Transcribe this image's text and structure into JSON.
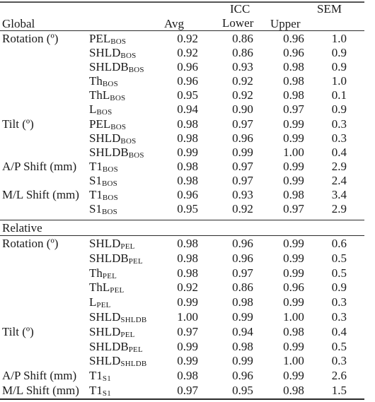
{
  "header": {
    "section_global": "Global",
    "col_avg": "Avg",
    "col_icc": "ICC",
    "col_lower": "Lower",
    "col_upper": "Upper",
    "col_sem": "SEM"
  },
  "global_rows": [
    {
      "group": "Rotation (º)",
      "sub": "PEL",
      "subscript": "BOS",
      "avg": "0.92",
      "lower": "0.86",
      "upper": "0.96",
      "sem": "1.0"
    },
    {
      "group": "",
      "sub": "SHLD",
      "subscript": "BOS",
      "avg": "0.92",
      "lower": "0.86",
      "upper": "0.96",
      "sem": "0.9"
    },
    {
      "group": "",
      "sub": "SHLDB",
      "subscript": "BOS",
      "avg": "0.96",
      "lower": "0.93",
      "upper": "0.98",
      "sem": "0.9"
    },
    {
      "group": "",
      "sub": "Th",
      "subscript": "BOS",
      "avg": "0.96",
      "lower": "0.92",
      "upper": "0.98",
      "sem": "1.0"
    },
    {
      "group": "",
      "sub": "ThL",
      "subscript": "BOS",
      "avg": "0.95",
      "lower": "0.92",
      "upper": "0.98",
      "sem": "0.1"
    },
    {
      "group": "",
      "sub": "L",
      "subscript": "BOS",
      "avg": "0.94",
      "lower": "0.90",
      "upper": "0.97",
      "sem": "0.9"
    },
    {
      "group": "Tilt (º)",
      "sub": "PEL",
      "subscript": "BOS",
      "avg": "0.98",
      "lower": "0.97",
      "upper": "0.99",
      "sem": "0.3"
    },
    {
      "group": "",
      "sub": "SHLD",
      "subscript": "BOS",
      "avg": "0.98",
      "lower": "0.96",
      "upper": "0.99",
      "sem": "0.3"
    },
    {
      "group": "",
      "sub": "SHLDB",
      "subscript": "BOS",
      "avg": "0.99",
      "lower": "0.99",
      "upper": "1.00",
      "sem": "0.4"
    },
    {
      "group": "A/P Shift (mm)",
      "sub": "T1",
      "subscript": "BOS",
      "avg": "0.98",
      "lower": "0.97",
      "upper": "0.99",
      "sem": "2.9"
    },
    {
      "group": "",
      "sub": "S1",
      "subscript": "BOS",
      "avg": "0.98",
      "lower": "0.97",
      "upper": "0.99",
      "sem": "2.4"
    },
    {
      "group": "M/L Shift (mm)",
      "sub": "T1",
      "subscript": "BOS",
      "avg": "0.96",
      "lower": "0.93",
      "upper": "0.98",
      "sem": "3.4"
    },
    {
      "group": "",
      "sub": "S1",
      "subscript": "BOS",
      "avg": "0.95",
      "lower": "0.92",
      "upper": "0.97",
      "sem": "2.9"
    }
  ],
  "section_relative": "Relative",
  "relative_rows": [
    {
      "group": "Rotation (º)",
      "sub": "SHLD",
      "subscript": "PEL",
      "avg": "0.98",
      "lower": "0.96",
      "upper": "0.99",
      "sem": "0.6"
    },
    {
      "group": "",
      "sub": "SHLDB",
      "subscript": "PEL",
      "avg": "0.98",
      "lower": "0.96",
      "upper": "0.99",
      "sem": "0.5"
    },
    {
      "group": "",
      "sub": "Th",
      "subscript": "PEL",
      "avg": "0.98",
      "lower": "0.97",
      "upper": "0.99",
      "sem": "0.5"
    },
    {
      "group": "",
      "sub": "ThL",
      "subscript": "PEL",
      "avg": "0.92",
      "lower": "0.86",
      "upper": "0.96",
      "sem": "0.9"
    },
    {
      "group": "",
      "sub": "L",
      "subscript": "PEL",
      "avg": "0.99",
      "lower": "0.98",
      "upper": "0.99",
      "sem": "0.3"
    },
    {
      "group": "",
      "sub": "SHLD",
      "subscript": "SHLDB",
      "avg": "1.00",
      "lower": "0.99",
      "upper": "1.00",
      "sem": "0.3"
    },
    {
      "group": "Tilt (º)",
      "sub": "SHLD",
      "subscript": "PEL",
      "avg": "0.97",
      "lower": "0.94",
      "upper": "0.98",
      "sem": "0.4"
    },
    {
      "group": "",
      "sub": "SHLDB",
      "subscript": "PEL",
      "avg": "0.99",
      "lower": "0.98",
      "upper": "0.99",
      "sem": "0.5"
    },
    {
      "group": "",
      "sub": "SHLD",
      "subscript": "SHLDB",
      "avg": "0.99",
      "lower": "0.99",
      "upper": "1.00",
      "sem": "0.3"
    },
    {
      "group": "A/P Shift (mm)",
      "sub": "T1",
      "subscript": "S1",
      "avg": "0.98",
      "lower": "0.96",
      "upper": "0.99",
      "sem": "2.6"
    },
    {
      "group": "M/L Shift (mm)",
      "sub": "T1",
      "subscript": "S1",
      "avg": "0.97",
      "lower": "0.95",
      "upper": "0.98",
      "sem": "1.5"
    }
  ]
}
